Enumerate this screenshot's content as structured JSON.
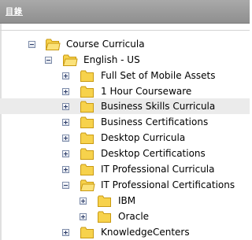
{
  "panel": {
    "title": "目錄"
  },
  "tree": {
    "root": {
      "label": "Course Curricula",
      "toggle": "minus"
    },
    "locale": {
      "label": "English - US",
      "toggle": "minus"
    },
    "items": [
      {
        "label": "Full Set of Mobile Assets",
        "toggle": "plus"
      },
      {
        "label": "1 Hour Courseware",
        "toggle": "plus"
      },
      {
        "label": "Business Skills Curricula",
        "toggle": "plus"
      },
      {
        "label": "Business Certifications",
        "toggle": "plus"
      },
      {
        "label": "Desktop Curricula",
        "toggle": "plus"
      },
      {
        "label": "Desktop Certifications",
        "toggle": "plus"
      },
      {
        "label": "IT Professional Curricula",
        "toggle": "plus"
      },
      {
        "label": "IT Professional Certifications",
        "toggle": "minus"
      }
    ],
    "subitems": [
      {
        "label": "IBM",
        "toggle": "plus"
      },
      {
        "label": "Oracle",
        "toggle": "plus"
      }
    ],
    "last": {
      "label": "KnowledgeCenters",
      "toggle": "plus"
    }
  },
  "colors": {
    "header_bg": "#999999",
    "highlight_row": "#ebebeb",
    "folder_fill": "#f7d24c",
    "folder_stroke": "#c99a12",
    "toggle_border": "#7b8aa8"
  },
  "icons": {
    "folder": "folder-icon",
    "expand": "expand-icon",
    "collapse": "collapse-icon"
  }
}
